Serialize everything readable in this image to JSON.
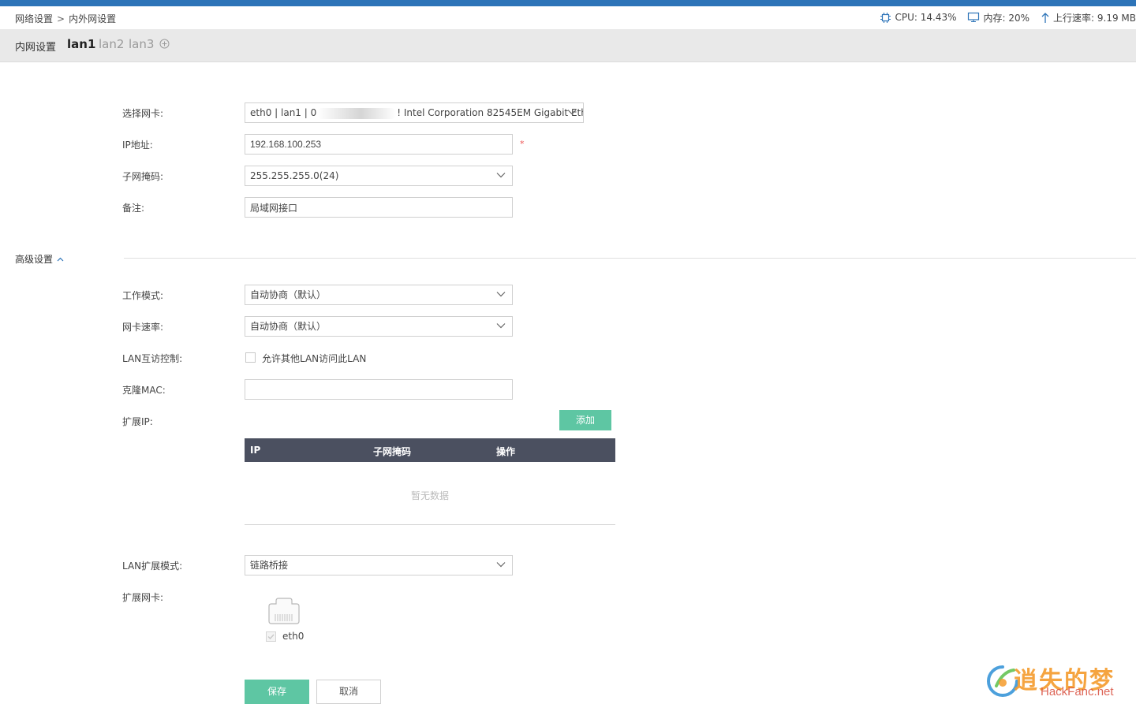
{
  "breadcrumb": {
    "parent": "网络设置",
    "separator": ">",
    "current": "内外网设置"
  },
  "stats": {
    "cpu": "CPU: 14.43%",
    "memory": "内存: 20%",
    "upload": "上行速率: 9.19 MB"
  },
  "tabs": {
    "section_label": "内网设置",
    "items": [
      "lan1",
      "lan2",
      "lan3"
    ],
    "active": "lan1",
    "add_symbol": "⊕"
  },
  "form": {
    "nic": {
      "label": "选择网卡:",
      "value_prefix": "eth0 | lan1 | 0",
      "value_suffix": "! Intel Corporation 82545EM Gigabit Eth"
    },
    "ip": {
      "label": "IP地址:",
      "value": "192.168.100.253",
      "required_mark": "*"
    },
    "subnet": {
      "label": "子网掩码:",
      "value": "255.255.255.0(24)"
    },
    "remark": {
      "label": "备注:",
      "value": "局域网接口"
    }
  },
  "advanced": {
    "title": "高级设置",
    "work_mode": {
      "label": "工作模式:",
      "value": "自动协商（默认）"
    },
    "nic_speed": {
      "label": "网卡速率:",
      "value": "自动协商（默认）"
    },
    "lan_access": {
      "label": "LAN互访控制:",
      "checkbox_label": "允许其他LAN访问此LAN",
      "checked": false
    },
    "clone_mac": {
      "label": "克隆MAC:",
      "value": ""
    },
    "ext_ip": {
      "label": "扩展IP:",
      "add_button": "添加",
      "columns": [
        "IP",
        "子网掩码",
        "操作"
      ],
      "empty_text": "暂无数据"
    },
    "lan_ext_mode": {
      "label": "LAN扩展模式:",
      "value": "链路桥接"
    },
    "ext_nic": {
      "label": "扩展网卡:",
      "nic_name": "eth0",
      "checked": true
    }
  },
  "actions": {
    "save": "保存",
    "cancel": "取消"
  },
  "watermark": {
    "cn": "逍失的梦",
    "en": "HackFanc.net"
  },
  "colors": {
    "accent": "#5ec6a3",
    "topbar": "#2d74b8",
    "table_header": "#4b5060"
  }
}
